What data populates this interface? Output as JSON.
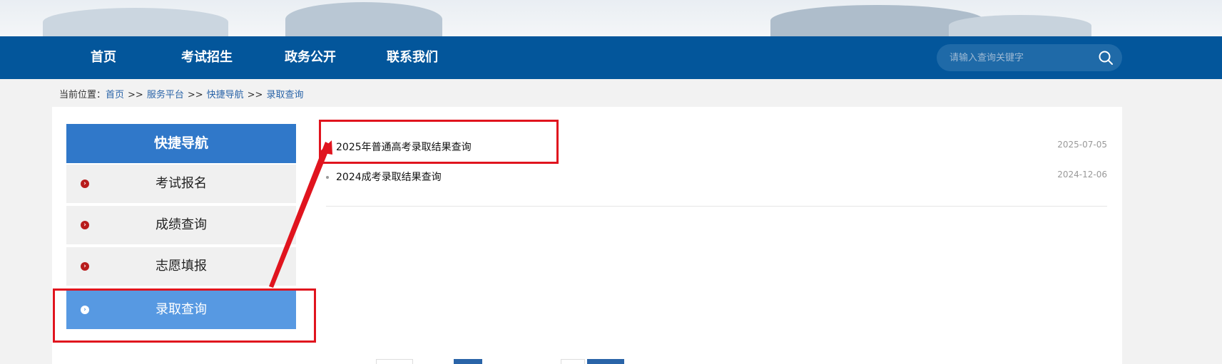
{
  "nav": {
    "items": [
      {
        "label": "首页"
      },
      {
        "label": "考试招生"
      },
      {
        "label": "政务公开"
      },
      {
        "label": "联系我们"
      }
    ],
    "search_placeholder": "请输入查询关键字"
  },
  "breadcrumb": {
    "prefix": "当前位置：",
    "separator": ">>",
    "links": [
      "首页",
      "服务平台",
      "快捷导航",
      "录取查询"
    ]
  },
  "sidebar": {
    "title": "快捷导航",
    "items": [
      {
        "label": "考试报名",
        "active": false
      },
      {
        "label": "成绩查询",
        "active": false
      },
      {
        "label": "志愿填报",
        "active": false
      },
      {
        "label": "录取查询",
        "active": true
      }
    ]
  },
  "list": {
    "items": [
      {
        "title": "2025年普通高考录取结果查询",
        "date": "2025-07-05"
      },
      {
        "title": "2024成考录取结果查询",
        "date": "2024-12-06"
      }
    ]
  },
  "colors": {
    "nav_bg": "#03569b",
    "sidebar_head": "#3078c9",
    "sidebar_active": "#5799e2",
    "annotation": "#e0141e",
    "link": "#2a64a8"
  }
}
